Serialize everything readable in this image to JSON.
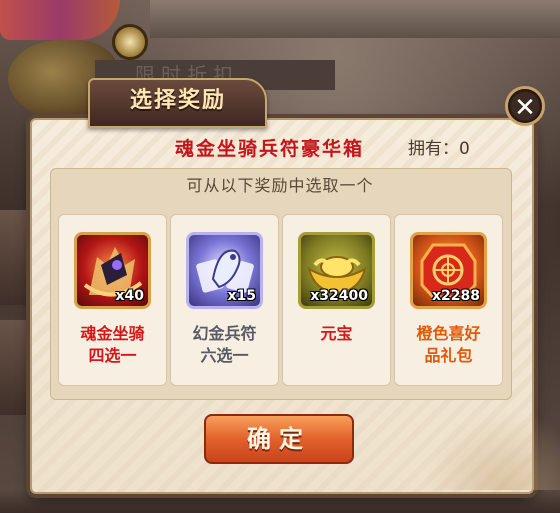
{
  "dialog": {
    "title": "选择奖励",
    "close_label": "✕",
    "chest_name": "魂金坐骑兵符豪华箱",
    "owned_label": "拥有：",
    "owned_count": "0",
    "instruction": "可从以下奖励中选取一个",
    "confirm_label": "确定"
  },
  "rewards": [
    {
      "name_line1": "魂金坐骑",
      "name_line2": "四选一",
      "quantity": "x40",
      "icon": "mount-icon",
      "color": "#d4181a"
    },
    {
      "name_line1": "幻金兵符",
      "name_line2": "六选一",
      "quantity": "x15",
      "icon": "tiger-tally-icon",
      "color": "#5a5a66"
    },
    {
      "name_line1": "元宝",
      "name_line2": "",
      "quantity": "x32400",
      "icon": "gold-ingot-icon",
      "color": "#d4181a"
    },
    {
      "name_line1": "橙色喜好",
      "name_line2": "品礼包",
      "quantity": "x2288",
      "icon": "gift-pack-icon",
      "color": "#e05a0a"
    }
  ],
  "background": {
    "banner_text": "限时折扣"
  },
  "colors": {
    "title_text": "#ffe7b3",
    "chest_name": "#c4161a",
    "confirm_button": "#e2612c",
    "dialog_bg": "#f6ecdc"
  }
}
